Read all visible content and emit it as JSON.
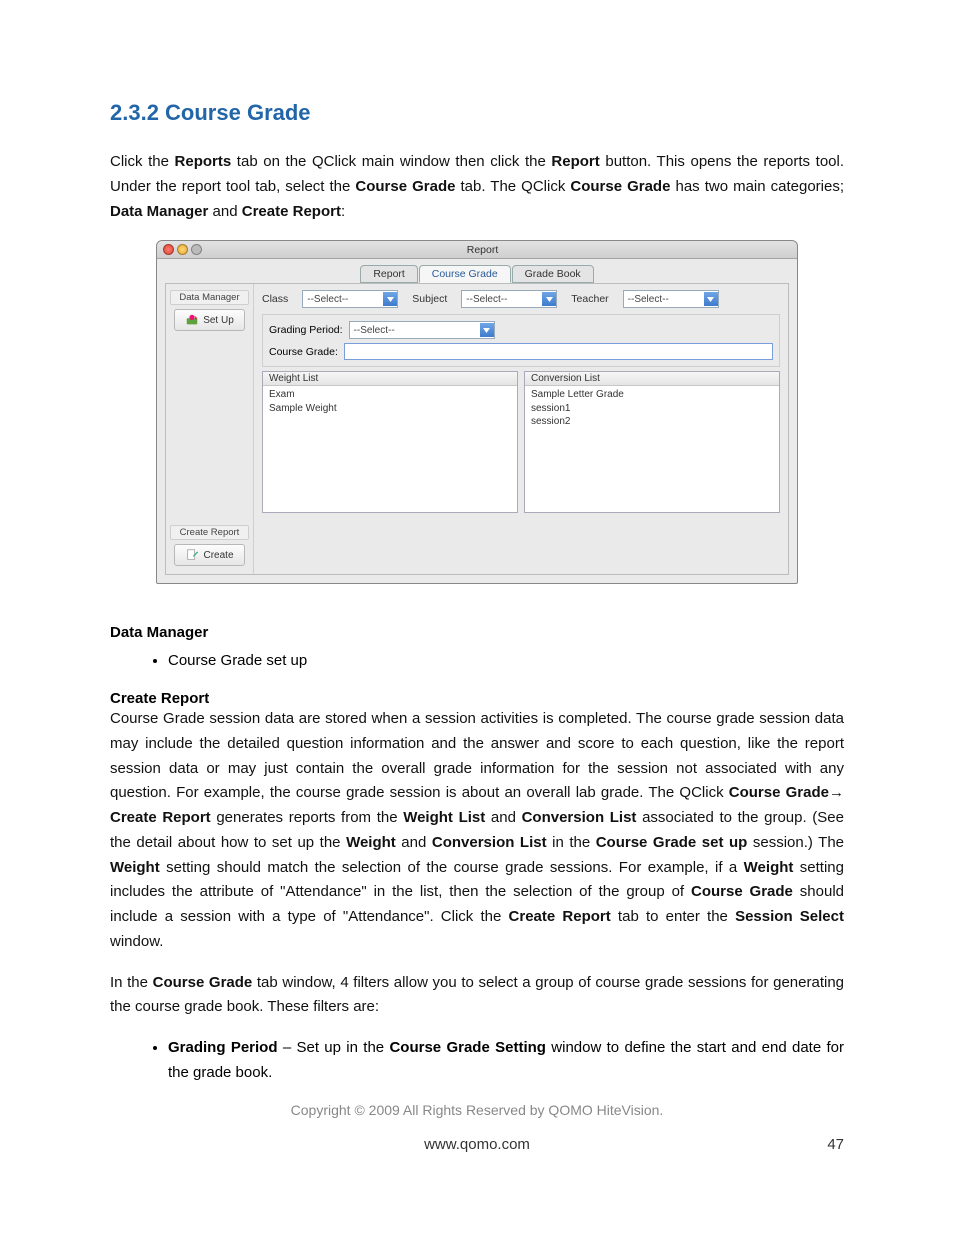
{
  "heading": "2.3.2 Course Grade",
  "intro": {
    "p1_a": "Click the ",
    "p1_b": "Reports",
    "p1_c": " tab on the QClick main window then click the ",
    "p1_d": "Report",
    "p1_e": " button. This opens the reports tool. Under the report tool tab, select the ",
    "p1_f": "Course Grade",
    "p1_g": " tab. The QClick ",
    "p1_h": "Course Grade",
    "p1_i": " has two main categories; ",
    "p1_j": "Data Manager",
    "p1_k": " and ",
    "p1_l": "Create Report",
    "p1_m": ":"
  },
  "window": {
    "title": "Report",
    "tabs": {
      "report": "Report",
      "course_grade": "Course Grade",
      "grade_book": "Grade Book"
    },
    "sidebar": {
      "data_manager": "Data Manager",
      "setup": "Set Up",
      "create_report": "Create Report",
      "create": "Create"
    },
    "filters": {
      "class_lbl": "Class",
      "subject_lbl": "Subject",
      "teacher_lbl": "Teacher",
      "grading_period_lbl": "Grading Period:",
      "course_grade_lbl": "Course Grade:",
      "select_placeholder": "--Select--"
    },
    "weight_list": {
      "header": "Weight List",
      "items": [
        "Exam",
        "Sample Weight"
      ]
    },
    "conversion_list": {
      "header": "Conversion List",
      "items": [
        "Sample Letter Grade",
        "session1",
        "session2"
      ]
    }
  },
  "data_manager_head": "Data Manager",
  "data_manager_bullet": "Course Grade set up",
  "create_report_head": "Create Report",
  "cr_para": {
    "a": "Course Grade session data are stored when a session activities is completed. The course grade session data may include the detailed question information and the answer and score to each question, like the report session data or may just contain the overall grade information for the session not associated with any question. For example, the course grade session is about an overall lab grade. The QClick ",
    "b": "Course Grade",
    "arrow": "→",
    "c": " Create Report",
    "d": " generates reports from the ",
    "e": "Weight List",
    "f": " and ",
    "g": "Conversion List",
    "h": " associated to the group. (See the detail about how to set up the ",
    "i": "Weight",
    "j": " and ",
    "k": "Conversion List",
    "l": " in the ",
    "m": "Course Grade set up",
    "n": " session.) The ",
    "o": "Weight",
    "p": " setting should match the selection of the course grade sessions. For example, if a ",
    "q": "Weight",
    "r": " setting includes the attribute of \"Attendance\" in the list, then the selection of the group of ",
    "s": "Course Grade",
    "t": " should include a session with a type of \"Attendance\". Click the ",
    "u": "Create Report",
    "v": " tab to enter the ",
    "w": "Session Select",
    "x": " window."
  },
  "filters_para": {
    "a": "In the ",
    "b": "Course Grade",
    "c": " tab window, 4 filters allow you to select a group of course grade sessions for generating the course grade book. These filters are:"
  },
  "bullet_gp": {
    "a": "Grading Period",
    "b": " – Set up in the ",
    "c": "Course Grade Setting",
    "d": " window to define the start and end date for the grade book."
  },
  "copyright": "Copyright © 2009 All Rights Reserved by QOMO HiteVision.",
  "url": "www.qomo.com",
  "page_num": "47"
}
